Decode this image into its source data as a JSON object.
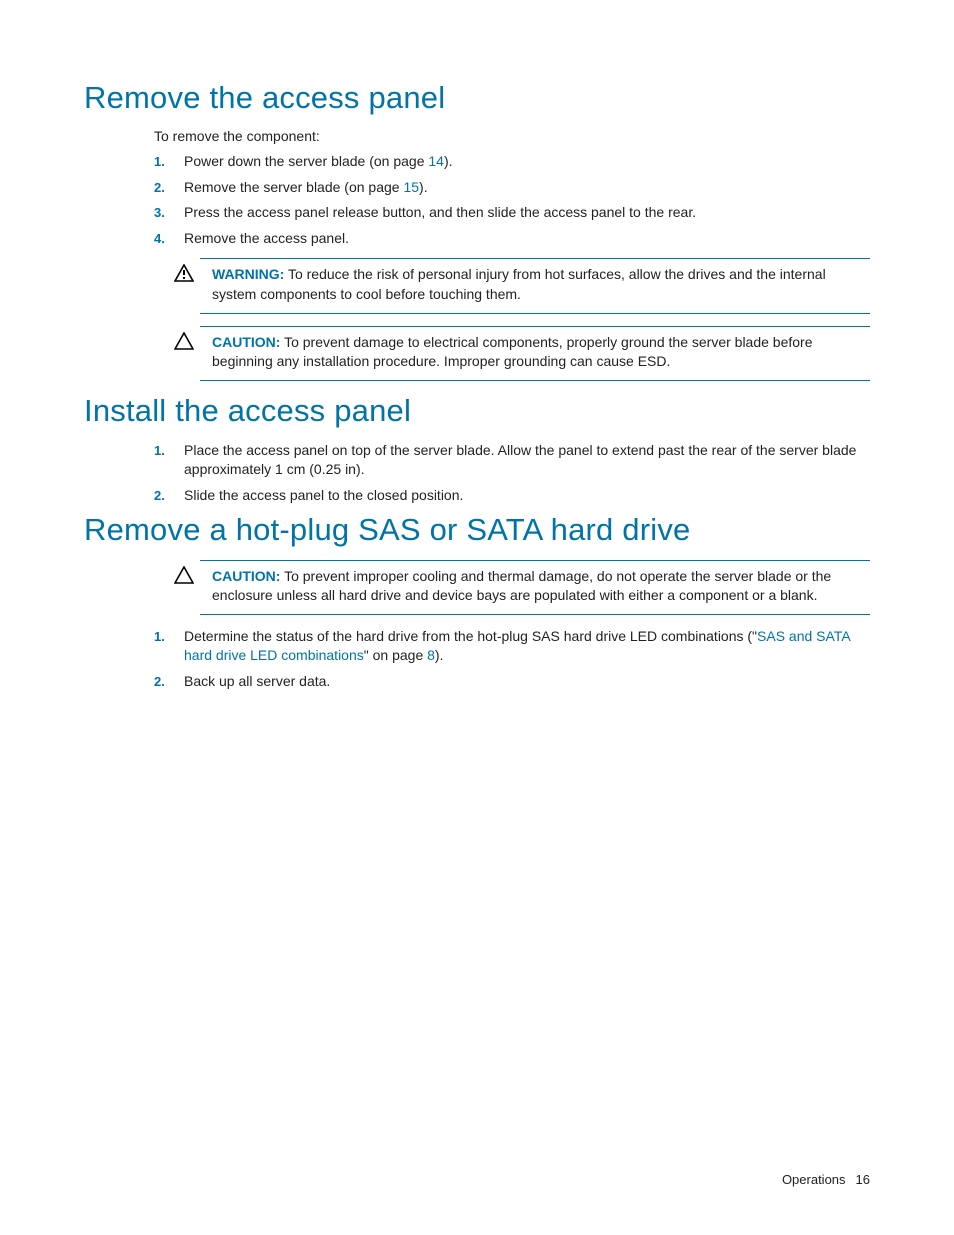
{
  "section1": {
    "title": "Remove the access panel",
    "intro": "To remove the component:",
    "steps": [
      {
        "num": "1.",
        "pre": "Power down the server blade (on page ",
        "link": "14",
        "post": ")."
      },
      {
        "num": "2.",
        "pre": "Remove the server blade (on page ",
        "link": "15",
        "post": ")."
      },
      {
        "num": "3.",
        "text": "Press the access panel release button, and then slide the access panel to the rear."
      },
      {
        "num": "4.",
        "text": "Remove the access panel."
      }
    ],
    "warning": {
      "label": "WARNING:",
      "text": "  To reduce the risk of personal injury from hot surfaces, allow the drives and the internal system components to cool before touching them."
    },
    "caution": {
      "label": "CAUTION:",
      "text": "  To prevent damage to electrical components, properly ground the server blade before beginning any installation procedure. Improper grounding can cause ESD."
    }
  },
  "section2": {
    "title": "Install the access panel",
    "steps": [
      {
        "num": "1.",
        "text": "Place the access panel on top of the server blade. Allow the panel to extend past the rear of the server blade approximately 1 cm (0.25 in)."
      },
      {
        "num": "2.",
        "text": "Slide the access panel to the closed position."
      }
    ]
  },
  "section3": {
    "title": "Remove a hot-plug SAS or SATA hard drive",
    "caution": {
      "label": "CAUTION:",
      "text": "  To prevent improper cooling and thermal damage, do not operate the server blade or the enclosure unless all hard drive and device bays are populated with either a component or a blank."
    },
    "steps": [
      {
        "num": "1.",
        "pre": "Determine the status of the hard drive from the hot-plug SAS hard drive LED combinations (\"",
        "link1": "SAS and SATA hard drive LED combinations",
        "mid": "\" on page ",
        "link2": "8",
        "post": ")."
      },
      {
        "num": "2.",
        "text": "Back up all server data."
      }
    ]
  },
  "footer": {
    "section": "Operations",
    "page": "16"
  }
}
